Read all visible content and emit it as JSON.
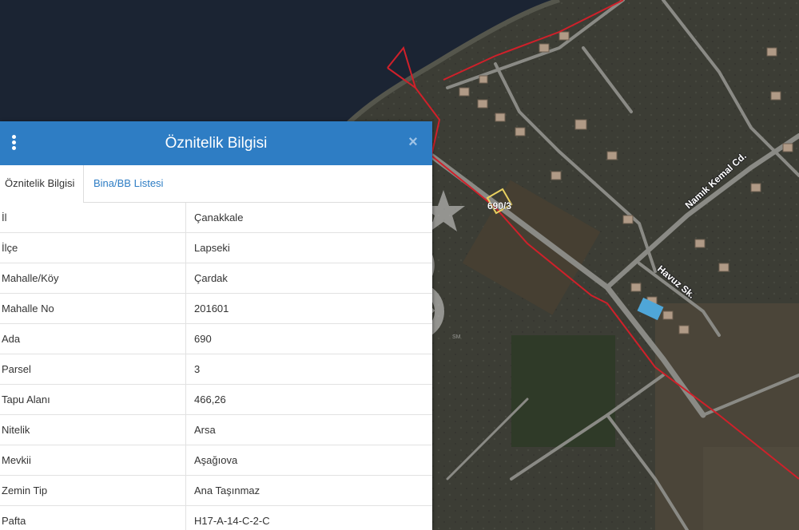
{
  "panel": {
    "title": "Öznitelik Bilgisi",
    "header_color": "#2e7dc4",
    "close_icon": "×",
    "tabs": [
      {
        "label": "Öznitelik Bilgisi",
        "active": true
      },
      {
        "label": "Bina/BB Listesi",
        "active": false
      }
    ],
    "rows": [
      {
        "key": "İl",
        "value": "Çanakkale"
      },
      {
        "key": "İlçe",
        "value": "Lapseki"
      },
      {
        "key": "Mahalle/Köy",
        "value": "Çardak"
      },
      {
        "key": "Mahalle No",
        "value": "201601"
      },
      {
        "key": "Ada",
        "value": "690"
      },
      {
        "key": "Parsel",
        "value": "3"
      },
      {
        "key": "Tapu Alanı",
        "value": "466,26"
      },
      {
        "key": "Nitelik",
        "value": "Arsa"
      },
      {
        "key": "Mevkii",
        "value": "Aşağıova"
      },
      {
        "key": "Zemin Tip",
        "value": "Ana Taşınmaz"
      },
      {
        "key": "Pafta",
        "value": "H17-A-14-C-2-C"
      }
    ]
  },
  "map": {
    "parcel_label": "690/3",
    "street_labels": {
      "namik_kemal": "Namık Kemal Cd.",
      "havuz": "Havuz Sk."
    },
    "watermark": {
      "letters": "CB",
      "mark": "SM"
    },
    "colors": {
      "sea": "#1b2433",
      "land": "#3a3b33",
      "road": "#8a8a85",
      "boundary": "#d0202a",
      "parcel_highlight": "#e8d060"
    }
  }
}
